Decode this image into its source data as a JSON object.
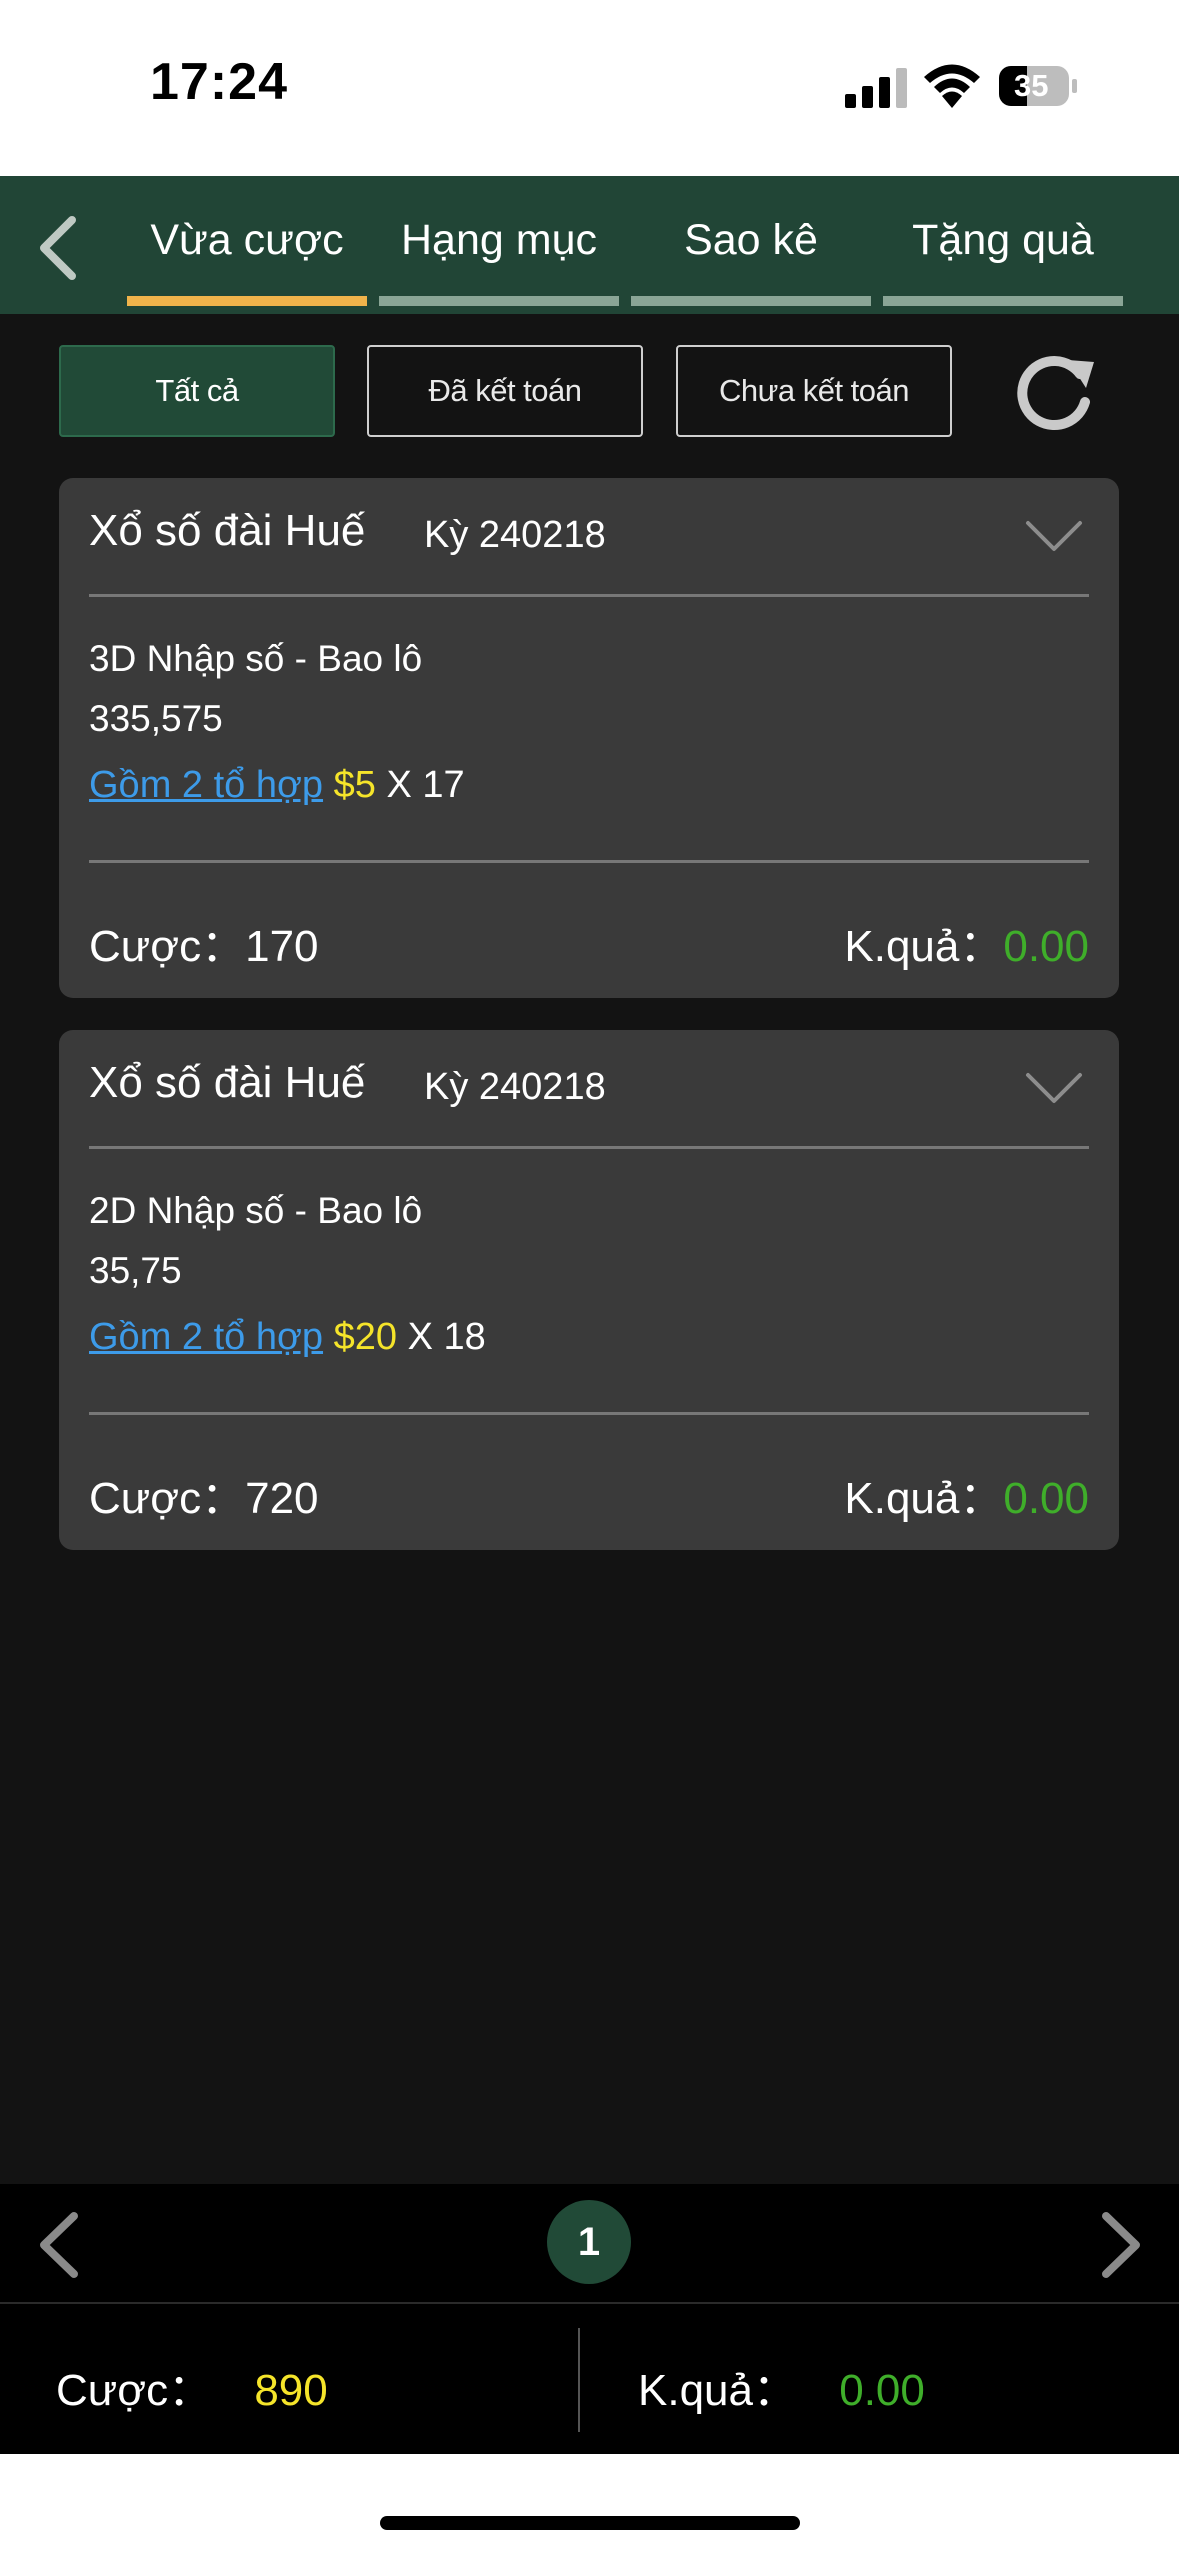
{
  "status_bar": {
    "time": "17:24",
    "battery": "35"
  },
  "nav": {
    "tabs": [
      {
        "label": "Vừa cược",
        "active": true
      },
      {
        "label": "Hạng mục",
        "active": false
      },
      {
        "label": "Sao kê",
        "active": false
      },
      {
        "label": "Tặng quà",
        "active": false
      }
    ]
  },
  "filters": [
    {
      "label": "Tất cả",
      "active": true
    },
    {
      "label": "Đã kết toán",
      "active": false
    },
    {
      "label": "Chưa kết toán",
      "active": false
    }
  ],
  "bets": [
    {
      "title": "Xổ số đài Huế",
      "period": "Kỳ 240218",
      "game": "3D Nhập số - Bao lô",
      "numbers": "335,575",
      "combo": "Gồm 2 tổ hợp",
      "stake": "$5",
      "multiplier": "X 17",
      "bet_label": "Cược：",
      "bet_value": "170",
      "result_label": "K.quả：",
      "result_value": "0.00"
    },
    {
      "title": "Xổ số đài Huế",
      "period": "Kỳ 240218",
      "game": "2D Nhập số - Bao lô",
      "numbers": "35,75",
      "combo": "Gồm 2 tổ hợp",
      "stake": "$20",
      "multiplier": "X 18",
      "bet_label": "Cược：",
      "bet_value": "720",
      "result_label": "K.quả：",
      "result_value": "0.00"
    }
  ],
  "pagination": {
    "current_page": "1"
  },
  "summary": {
    "bet_label": "Cược：",
    "bet_value": "890",
    "result_label": "K.quả：",
    "result_value": "0.00"
  },
  "colors": {
    "nav_bg": "#214536",
    "active_tab": "#f0b34b",
    "card_bg": "#3a3a3a",
    "link": "#3d9be9",
    "stake": "#f5e42a",
    "result": "#3fae2a"
  }
}
